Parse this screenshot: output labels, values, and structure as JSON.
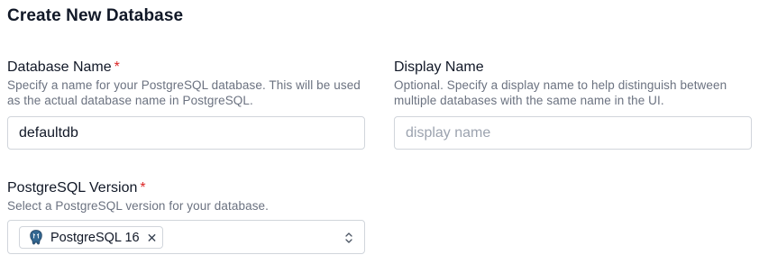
{
  "page": {
    "title": "Create New Database"
  },
  "database_name": {
    "label": "Database Name",
    "required_marker": "*",
    "help": "Specify a name for your PostgreSQL database. This will be used as the actual database name in PostgreSQL.",
    "value": "defaultdb",
    "placeholder": ""
  },
  "display_name": {
    "label": "Display Name",
    "help": "Optional. Specify a display name to help distinguish between multiple databases with the same name in the UI.",
    "value": "",
    "placeholder": "display name"
  },
  "postgres_version": {
    "label": "PostgreSQL Version",
    "required_marker": "*",
    "help": "Select a PostgreSQL version for your database.",
    "selected": {
      "label": "PostgreSQL 16",
      "icon": "postgresql-elephant-icon",
      "remove_glyph": "✕"
    },
    "chevron_icon": "chevron-up-down-icon"
  },
  "colors": {
    "required": "#dc2626",
    "help_text": "#6b7280",
    "border": "#d1d5db",
    "postgres_blue": "#336791"
  }
}
